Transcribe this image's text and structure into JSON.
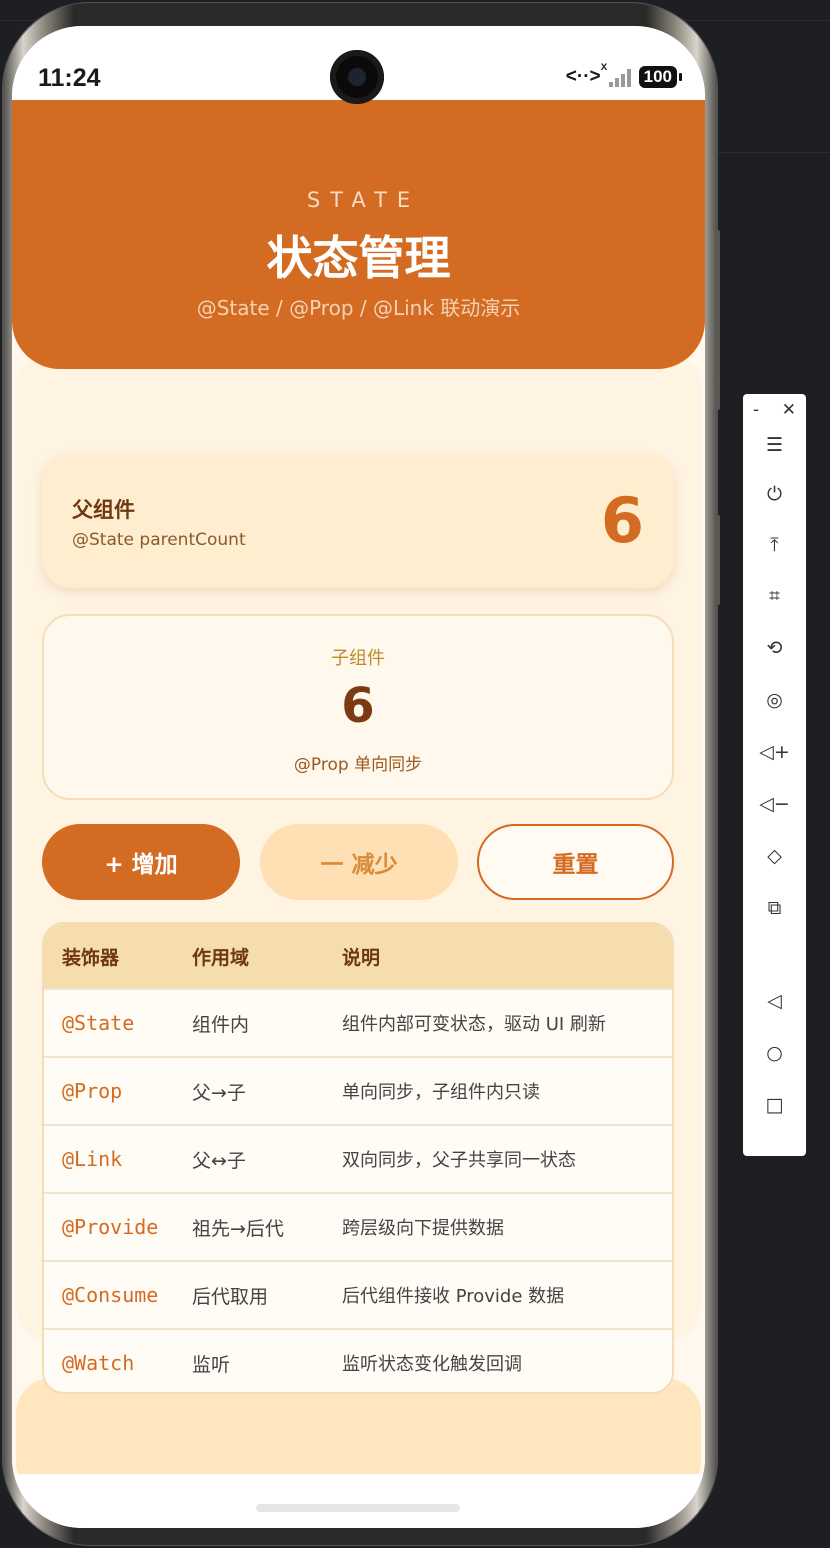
{
  "status_bar": {
    "time": "11:24",
    "data_indicator": "<··>",
    "battery": "100"
  },
  "header": {
    "eyebrow": "STATE",
    "title": "状态管理",
    "subtitle": "@State / @Prop / @Link 联动演示"
  },
  "parent": {
    "title": "父组件",
    "subtitle": "@State parentCount",
    "count": "6"
  },
  "child": {
    "title": "子组件",
    "count": "6",
    "subtitle": "@Prop 单向同步"
  },
  "buttons": {
    "add": "+  增加",
    "subtract": "一 减少",
    "reset": "重置"
  },
  "table": {
    "headers": [
      "装饰器",
      "作用域",
      "说明"
    ],
    "rows": [
      {
        "decorator": "@State",
        "scope": "组件内",
        "desc": "组件内部可变状态，驱动 UI 刷新"
      },
      {
        "decorator": "@Prop",
        "scope": "父→子",
        "desc": "单向同步，子组件内只读"
      },
      {
        "decorator": "@Link",
        "scope": "父↔子",
        "desc": "双向同步，父子共享同一状态"
      },
      {
        "decorator": "@Provide",
        "scope": "祖先→后代",
        "desc": "跨层级向下提供数据"
      },
      {
        "decorator": "@Consume",
        "scope": "后代取用",
        "desc": "后代组件接收 Provide 数据"
      },
      {
        "decorator": "@Watch",
        "scope": "监听",
        "desc": "监听状态变化触发回调"
      }
    ]
  },
  "toolbar": {
    "minimize": "-",
    "close": "✕",
    "items": [
      {
        "name": "menu-icon",
        "glyph": "☰"
      },
      {
        "name": "power-icon",
        "glyph": "⏻"
      },
      {
        "name": "pin-top-icon",
        "glyph": "⤒"
      },
      {
        "name": "crop-icon",
        "glyph": "⌗"
      },
      {
        "name": "rotate-icon",
        "glyph": "⟲"
      },
      {
        "name": "screenshot-icon",
        "glyph": "◎"
      },
      {
        "name": "volume-up-icon",
        "glyph": "◁+"
      },
      {
        "name": "volume-down-icon",
        "glyph": "◁−"
      },
      {
        "name": "shake-icon",
        "glyph": "◇"
      },
      {
        "name": "multi-device-icon",
        "glyph": "⧉"
      },
      {
        "name": "back-icon",
        "glyph": "◁"
      },
      {
        "name": "home-icon",
        "glyph": "○"
      },
      {
        "name": "recents-icon",
        "glyph": "□"
      }
    ]
  },
  "colors": {
    "accent": "#d46b22",
    "background": "#fff8ee",
    "table_header": "#f5ddb0"
  }
}
